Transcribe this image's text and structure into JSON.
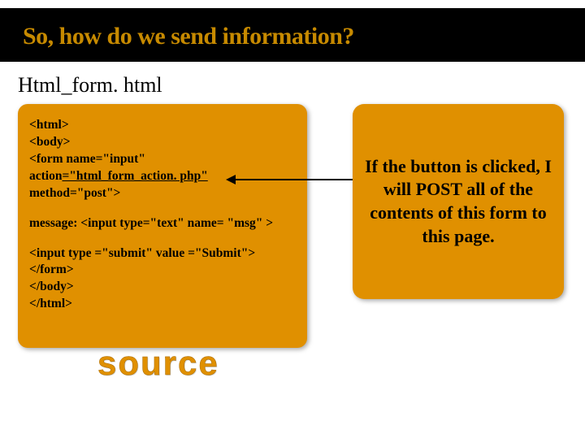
{
  "title": "So, how do we send information?",
  "subtitle": "Html_form. html",
  "code": {
    "l1": "<html>",
    "l2": "<body>",
    "l3": "<form name=\"input\"",
    "l4a": "action",
    "l4b": "=\"html_form_action. php\"",
    "l5": "method=\"post\">",
    "l6": "message: <input type=\"text\" name= \"msg\" >",
    "l7": "<input type =\"submit\" value =\"Submit\">",
    "l8": "</form>",
    "l9": "</body>",
    "l10": "</html>"
  },
  "callout": "If the button is clicked, I will POST all of the contents of this form to this page.",
  "source_label": "source"
}
